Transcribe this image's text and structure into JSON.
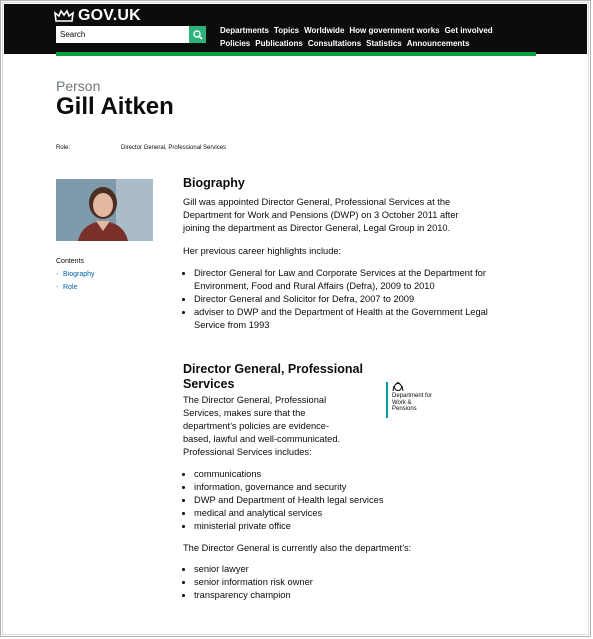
{
  "header": {
    "logo_text": "GOV.UK",
    "search_placeholder": "Search",
    "nav_row1": [
      "Departments",
      "Topics",
      "Worldwide",
      "How government works",
      "Get involved"
    ],
    "nav_row2": [
      "Policies",
      "Publications",
      "Consultations",
      "Statistics",
      "Announcements"
    ],
    "accent_color": "#00a33b"
  },
  "page": {
    "label": "Person",
    "title": "Gill Aitken",
    "role_key": "Role:",
    "role_value": "Director General, Professional Services"
  },
  "sidebar": {
    "contents_title": "Contents",
    "contents_items": [
      "Biography",
      "Role"
    ]
  },
  "biography": {
    "heading": "Biography",
    "para1": "Gill was appointed Director General, Professional Services at the Department for Work and Pensions (DWP) on 3 October 2011 after joining the department as Director General, Legal Group in 2010.",
    "para2": "Her previous career highlights include:",
    "highlights": [
      "Director General for Law and Corporate Services at the Department for Environment, Food and Rural Affairs (Defra), 2009 to 2010",
      "Director General and Solicitor for Defra, 2007 to 2009",
      "adviser to DWP and the Department of Health at the Government Legal Service from 1993"
    ]
  },
  "role": {
    "heading": "Director General, Professional Services",
    "dept_logo_text": "Department for Work & Pensions",
    "para1": "The Director General, Professional Services, makes sure that the department’s policies are evidence-based, lawful and well-communicated. Professional Services includes:",
    "services": [
      "communications",
      "information, governance and security",
      "DWP and Department of Health legal services",
      "medical and analytical services",
      "ministerial private office"
    ],
    "para2": "The Director General is currently also the department’s:",
    "duties": [
      "senior lawyer",
      "senior information risk owner",
      "transparency champion"
    ]
  }
}
